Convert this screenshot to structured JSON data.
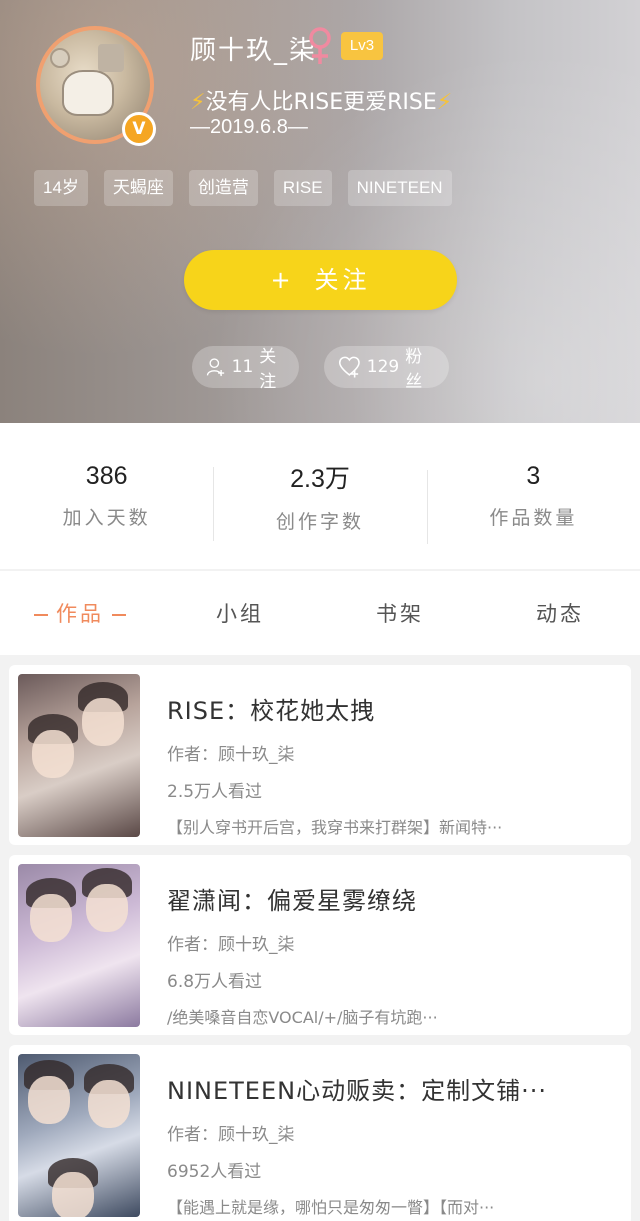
{
  "profile": {
    "username": "顾十玖_柒",
    "gender_symbol": "♀",
    "level": "Lv3",
    "verified_mark": "V",
    "motto_bolt": "⚡",
    "motto_text": "没有人比RISE更爱RISE",
    "date_line": "—2019.6.8—",
    "tags": [
      "14岁",
      "天蝎座",
      "创造营",
      "RISE",
      "NINETEEN"
    ],
    "follow_button": {
      "plus": "+",
      "label": "关注"
    },
    "following": {
      "count": "11",
      "label": "关注"
    },
    "fans": {
      "count": "129",
      "label": "粉丝"
    }
  },
  "stats": [
    {
      "value": "386",
      "label": "加入天数"
    },
    {
      "value": "2.3万",
      "label": "创作字数"
    },
    {
      "value": "3",
      "label": "作品数量"
    }
  ],
  "tabs": [
    {
      "label": "作品",
      "active": true
    },
    {
      "label": "小组",
      "active": false
    },
    {
      "label": "书架",
      "active": false
    },
    {
      "label": "动态",
      "active": false
    }
  ],
  "works": [
    {
      "title": "RISE：校花她太拽",
      "author": "作者：顾十玖_柒",
      "views": "2.5万人看过",
      "desc": "【别人穿书开后宫，我穿书来打群架】新闻特···"
    },
    {
      "title": "翟潇闻：偏爱星雾缭绕",
      "author": "作者：顾十玖_柒",
      "views": "6.8万人看过",
      "desc": "/绝美嗓音自恋VOCAl/+/脑子有坑跑···"
    },
    {
      "title": "NINETEEN心动贩卖：定制文铺···",
      "author": "作者：顾十玖_柒",
      "views": "6952人看过",
      "desc": "【能遇上就是缘，哪怕只是匆匆一瞥】【而对···"
    }
  ],
  "colors": {
    "accent_orange": "#f08a5c",
    "follow_yellow": "#f7d41a",
    "level_badge": "#f8c440",
    "female_pink": "#f08aa0"
  }
}
